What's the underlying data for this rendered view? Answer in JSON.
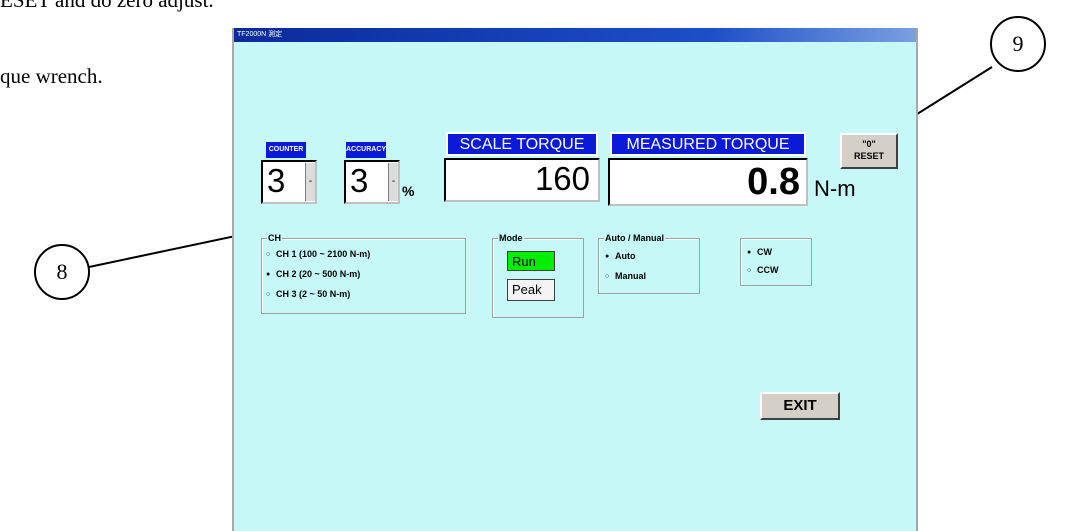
{
  "document": {
    "fragment_top": "ESET and do zero adjust.",
    "fragment_line2": "que wrench."
  },
  "callouts": {
    "c8": "8",
    "c9": "9"
  },
  "window": {
    "title": "TF2000N 測定",
    "counter": {
      "label": "COUNTER",
      "value": "3",
      "spin": "-"
    },
    "accuracy": {
      "label": "ACCURACY",
      "value": "3",
      "spin": "-",
      "unit": "%"
    },
    "scale_torque": {
      "label": "SCALE TORQUE",
      "value": "160"
    },
    "measured_torque": {
      "label": "MEASURED TORQUE",
      "value": "0.8",
      "unit": "N-m"
    },
    "reset_button": {
      "line1": "\"0\"",
      "line2": "RESET"
    },
    "ch_group": {
      "title": "CH",
      "options": [
        {
          "label": "CH 1 (100 ~ 2100 N-m)",
          "selected": false
        },
        {
          "label": "CH 2 (20 ~ 500 N-m)",
          "selected": true
        },
        {
          "label": "CH 3 (2 ~ 50 N-m)",
          "selected": false
        }
      ]
    },
    "mode_group": {
      "title": "Mode",
      "run": "Run",
      "peak": "Peak",
      "run_color": "#00ee00"
    },
    "auto_manual_group": {
      "title": "Auto / Manual",
      "options": [
        {
          "label": "Auto",
          "selected": true
        },
        {
          "label": "Manual",
          "selected": false
        }
      ]
    },
    "direction_group": {
      "options": [
        {
          "label": "CW",
          "selected": true
        },
        {
          "label": "CCW",
          "selected": false
        }
      ]
    },
    "exit_label": "EXIT"
  },
  "colors": {
    "window_bg": "#c6f8f8",
    "header_blue": "#0a1ad8",
    "run_green": "#00ee00"
  }
}
